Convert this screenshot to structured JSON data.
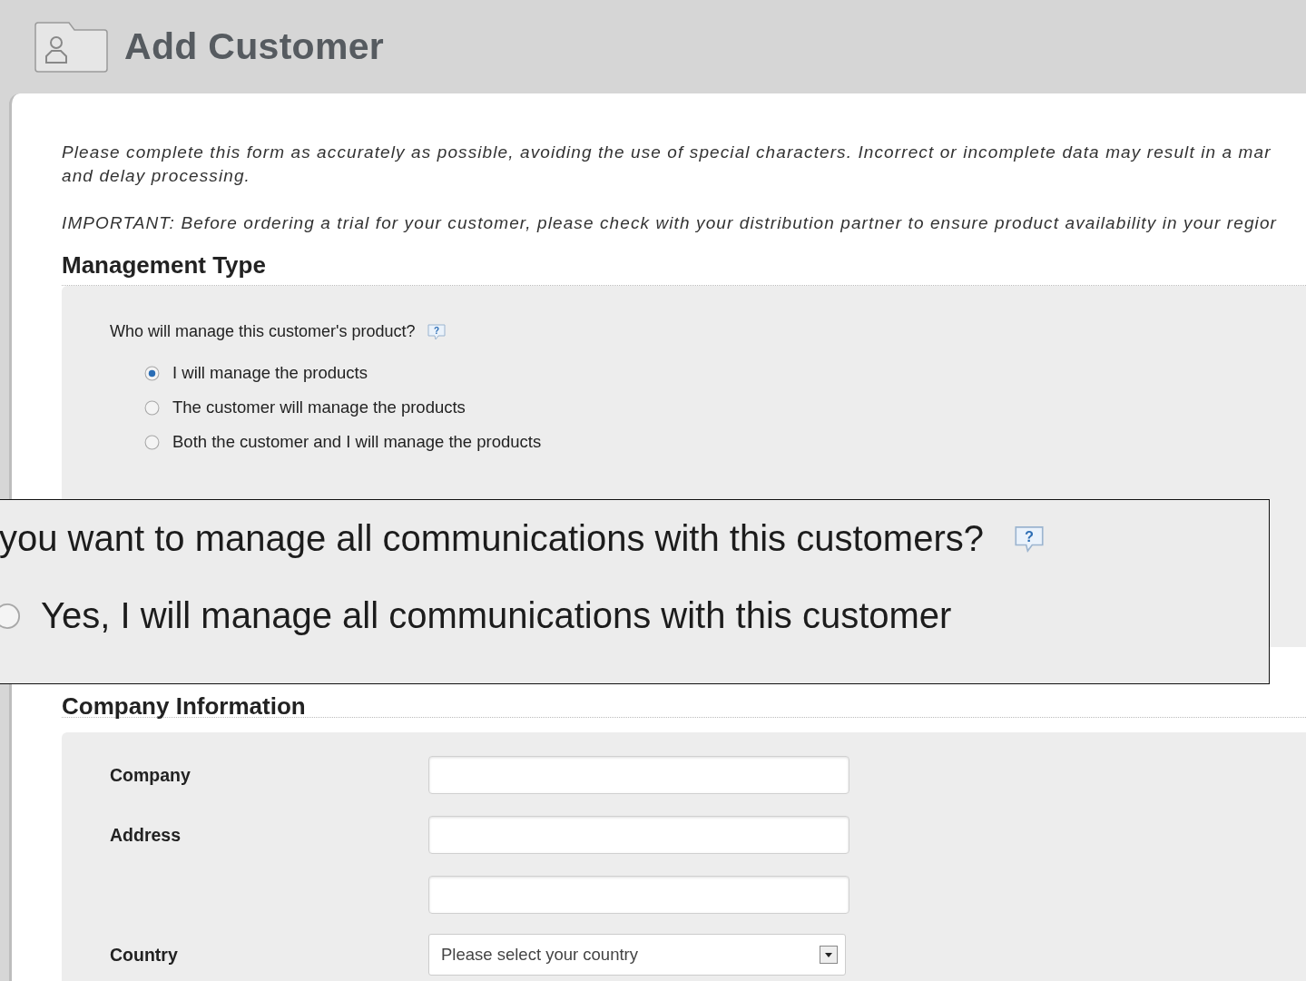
{
  "header": {
    "title": "Add Customer"
  },
  "intro": {
    "lines": [
      "Please complete this form as accurately as possible, avoiding the use of special characters. Incorrect or incomplete data may result in a mar",
      "and delay processing."
    ],
    "important": "IMPORTANT: Before ordering a trial for your customer, please check with your distribution partner to ensure product availability in your regior"
  },
  "management": {
    "heading": "Management Type",
    "question": "Who will manage this customer's product?",
    "help": "?",
    "options": [
      {
        "label": "I will manage the products",
        "selected": true
      },
      {
        "label": "The customer will manage the products",
        "selected": false
      },
      {
        "label": "Both the customer and I will manage the products",
        "selected": false
      }
    ]
  },
  "callout": {
    "question": "you want to manage all communications with this customers?",
    "help": "?",
    "options": [
      {
        "label": "Yes, I will manage all communications with this customer",
        "selected": false
      }
    ]
  },
  "company": {
    "heading": "Company Information",
    "fields": [
      {
        "kind": "text",
        "label": "Company"
      },
      {
        "kind": "text",
        "label": "Address"
      },
      {
        "kind": "text"
      },
      {
        "kind": "select",
        "label": "Country",
        "placeholder": "Please select your country"
      }
    ]
  }
}
